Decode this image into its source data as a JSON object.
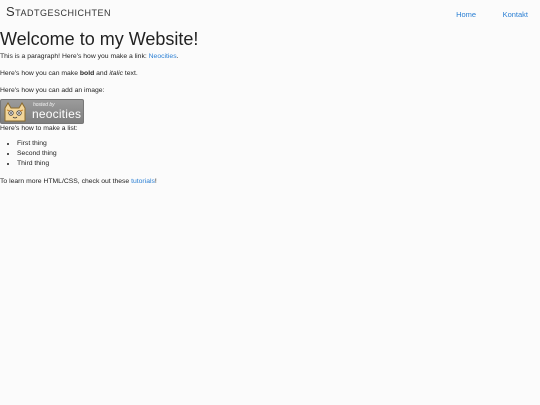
{
  "navbar": {
    "brand": "Stadtgeschichten",
    "links": [
      "Home",
      "Kontakt"
    ]
  },
  "main": {
    "title": "Welcome to my Website!",
    "p1_text": "This is a paragraph! Here's how you make a link: ",
    "p1_link": "Neocities",
    "p1_end": ".",
    "p2_a": "Here's how you can make ",
    "p2_bold": "bold",
    "p2_b": " and ",
    "p2_italic": "italic",
    "p2_c": " text.",
    "p3": "Here's how you can add an image:",
    "badge": {
      "small": "hosted by",
      "big": "neocities"
    },
    "p4": "Here's how to make a list:",
    "list": [
      "First thing",
      "Second thing",
      "Third thing"
    ],
    "p5_text": "To learn more HTML/CSS, check out these ",
    "p5_link": "tutorials",
    "p5_end": "!"
  }
}
